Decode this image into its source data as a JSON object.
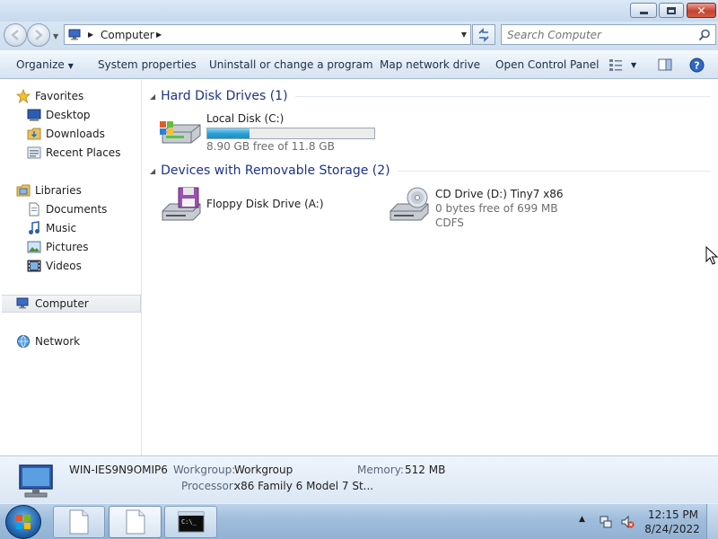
{
  "window": {
    "address": {
      "location": "Computer"
    },
    "search": {
      "placeholder": "Search Computer"
    }
  },
  "toolbar": {
    "organize": "Organize",
    "system_properties": "System properties",
    "uninstall": "Uninstall or change a program",
    "map_drive": "Map network drive",
    "control_panel": "Open Control Panel"
  },
  "sidebar": {
    "favorites": {
      "label": "Favorites",
      "items": [
        "Desktop",
        "Downloads",
        "Recent Places"
      ]
    },
    "libraries": {
      "label": "Libraries",
      "items": [
        "Documents",
        "Music",
        "Pictures",
        "Videos"
      ]
    },
    "computer": "Computer",
    "network": "Network"
  },
  "content": {
    "hard_disks": {
      "title": "Hard Disk Drives (1)",
      "drives": [
        {
          "name": "Local Disk (C:)",
          "free_text": "8.90 GB free of 11.8 GB",
          "used_fraction": 0.25
        }
      ]
    },
    "removable": {
      "title": "Devices with Removable Storage (2)",
      "drives": [
        {
          "name": "Floppy Disk Drive (A:)"
        },
        {
          "name": "CD Drive (D:) Tiny7 x86",
          "free_text": "0 bytes free of 699 MB",
          "filesystem": "CDFS"
        }
      ]
    }
  },
  "details": {
    "computer_name": "WIN-IES9N9OMIP6",
    "workgroup_label": "Workgroup:",
    "workgroup_value": "Workgroup",
    "memory_label": "Memory:",
    "memory_value": "512 MB",
    "processor_label": "Processor:",
    "processor_value": "x86 Family 6 Model 7 St..."
  },
  "taskbar": {
    "time": "12:15 PM",
    "date": "8/24/2022"
  },
  "colors": {
    "accent": "#1e3287",
    "capacity_fill": "#2aa3d7",
    "close_button": "#c6432f"
  },
  "icons": [
    "computer-icon",
    "star-icon",
    "desktop-icon",
    "folder-icon",
    "library-icon",
    "music-icon",
    "pictures-icon",
    "videos-icon",
    "network-icon",
    "hard-disk-icon",
    "floppy-drive-icon",
    "cd-drive-icon",
    "search-icon",
    "refresh-icon",
    "help-icon",
    "start-orb-icon"
  ]
}
